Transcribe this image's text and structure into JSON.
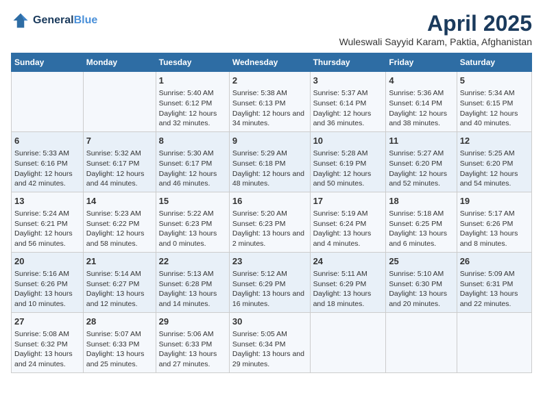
{
  "logo": {
    "line1": "General",
    "line2": "Blue"
  },
  "title": "April 2025",
  "subtitle": "Wuleswali Sayyid Karam, Paktia, Afghanistan",
  "days_of_week": [
    "Sunday",
    "Monday",
    "Tuesday",
    "Wednesday",
    "Thursday",
    "Friday",
    "Saturday"
  ],
  "weeks": [
    [
      {
        "day": "",
        "content": ""
      },
      {
        "day": "",
        "content": ""
      },
      {
        "day": "1",
        "content": "Sunrise: 5:40 AM\nSunset: 6:12 PM\nDaylight: 12 hours and 32 minutes."
      },
      {
        "day": "2",
        "content": "Sunrise: 5:38 AM\nSunset: 6:13 PM\nDaylight: 12 hours and 34 minutes."
      },
      {
        "day": "3",
        "content": "Sunrise: 5:37 AM\nSunset: 6:14 PM\nDaylight: 12 hours and 36 minutes."
      },
      {
        "day": "4",
        "content": "Sunrise: 5:36 AM\nSunset: 6:14 PM\nDaylight: 12 hours and 38 minutes."
      },
      {
        "day": "5",
        "content": "Sunrise: 5:34 AM\nSunset: 6:15 PM\nDaylight: 12 hours and 40 minutes."
      }
    ],
    [
      {
        "day": "6",
        "content": "Sunrise: 5:33 AM\nSunset: 6:16 PM\nDaylight: 12 hours and 42 minutes."
      },
      {
        "day": "7",
        "content": "Sunrise: 5:32 AM\nSunset: 6:17 PM\nDaylight: 12 hours and 44 minutes."
      },
      {
        "day": "8",
        "content": "Sunrise: 5:30 AM\nSunset: 6:17 PM\nDaylight: 12 hours and 46 minutes."
      },
      {
        "day": "9",
        "content": "Sunrise: 5:29 AM\nSunset: 6:18 PM\nDaylight: 12 hours and 48 minutes."
      },
      {
        "day": "10",
        "content": "Sunrise: 5:28 AM\nSunset: 6:19 PM\nDaylight: 12 hours and 50 minutes."
      },
      {
        "day": "11",
        "content": "Sunrise: 5:27 AM\nSunset: 6:20 PM\nDaylight: 12 hours and 52 minutes."
      },
      {
        "day": "12",
        "content": "Sunrise: 5:25 AM\nSunset: 6:20 PM\nDaylight: 12 hours and 54 minutes."
      }
    ],
    [
      {
        "day": "13",
        "content": "Sunrise: 5:24 AM\nSunset: 6:21 PM\nDaylight: 12 hours and 56 minutes."
      },
      {
        "day": "14",
        "content": "Sunrise: 5:23 AM\nSunset: 6:22 PM\nDaylight: 12 hours and 58 minutes."
      },
      {
        "day": "15",
        "content": "Sunrise: 5:22 AM\nSunset: 6:23 PM\nDaylight: 13 hours and 0 minutes."
      },
      {
        "day": "16",
        "content": "Sunrise: 5:20 AM\nSunset: 6:23 PM\nDaylight: 13 hours and 2 minutes."
      },
      {
        "day": "17",
        "content": "Sunrise: 5:19 AM\nSunset: 6:24 PM\nDaylight: 13 hours and 4 minutes."
      },
      {
        "day": "18",
        "content": "Sunrise: 5:18 AM\nSunset: 6:25 PM\nDaylight: 13 hours and 6 minutes."
      },
      {
        "day": "19",
        "content": "Sunrise: 5:17 AM\nSunset: 6:26 PM\nDaylight: 13 hours and 8 minutes."
      }
    ],
    [
      {
        "day": "20",
        "content": "Sunrise: 5:16 AM\nSunset: 6:26 PM\nDaylight: 13 hours and 10 minutes."
      },
      {
        "day": "21",
        "content": "Sunrise: 5:14 AM\nSunset: 6:27 PM\nDaylight: 13 hours and 12 minutes."
      },
      {
        "day": "22",
        "content": "Sunrise: 5:13 AM\nSunset: 6:28 PM\nDaylight: 13 hours and 14 minutes."
      },
      {
        "day": "23",
        "content": "Sunrise: 5:12 AM\nSunset: 6:29 PM\nDaylight: 13 hours and 16 minutes."
      },
      {
        "day": "24",
        "content": "Sunrise: 5:11 AM\nSunset: 6:29 PM\nDaylight: 13 hours and 18 minutes."
      },
      {
        "day": "25",
        "content": "Sunrise: 5:10 AM\nSunset: 6:30 PM\nDaylight: 13 hours and 20 minutes."
      },
      {
        "day": "26",
        "content": "Sunrise: 5:09 AM\nSunset: 6:31 PM\nDaylight: 13 hours and 22 minutes."
      }
    ],
    [
      {
        "day": "27",
        "content": "Sunrise: 5:08 AM\nSunset: 6:32 PM\nDaylight: 13 hours and 24 minutes."
      },
      {
        "day": "28",
        "content": "Sunrise: 5:07 AM\nSunset: 6:33 PM\nDaylight: 13 hours and 25 minutes."
      },
      {
        "day": "29",
        "content": "Sunrise: 5:06 AM\nSunset: 6:33 PM\nDaylight: 13 hours and 27 minutes."
      },
      {
        "day": "30",
        "content": "Sunrise: 5:05 AM\nSunset: 6:34 PM\nDaylight: 13 hours and 29 minutes."
      },
      {
        "day": "",
        "content": ""
      },
      {
        "day": "",
        "content": ""
      },
      {
        "day": "",
        "content": ""
      }
    ]
  ]
}
